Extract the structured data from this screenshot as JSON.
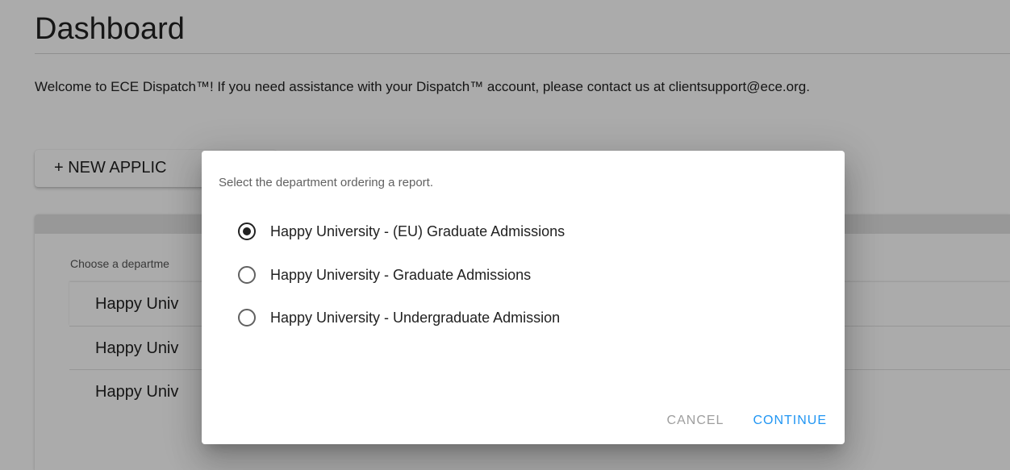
{
  "page": {
    "title": "Dashboard",
    "welcome": "Welcome to ECE Dispatch™! If you need assistance with your Dispatch™ account, please contact us at clientsupport@ece.org.",
    "new_application_label": "+ NEW APPLIC"
  },
  "department_card": {
    "hint": "Choose a departme",
    "rows": [
      {
        "label": "Happy Univ"
      },
      {
        "label": "Happy Univ"
      },
      {
        "label": "Happy Univ"
      }
    ]
  },
  "dialog": {
    "prompt": "Select the department ordering a report.",
    "selected_index": 0,
    "options": [
      {
        "label": "Happy University - (EU) Graduate Admissions",
        "checked": true
      },
      {
        "label": "Happy University - Graduate Admissions",
        "checked": false
      },
      {
        "label": "Happy University - Undergraduate Admission",
        "checked": false
      }
    ],
    "cancel_label": "CANCEL",
    "continue_label": "CONTINUE"
  },
  "colors": {
    "accent": "#2196f3",
    "disabled_text": "#9e9e9e",
    "overlay": "rgba(0,0,0,0.33)"
  }
}
